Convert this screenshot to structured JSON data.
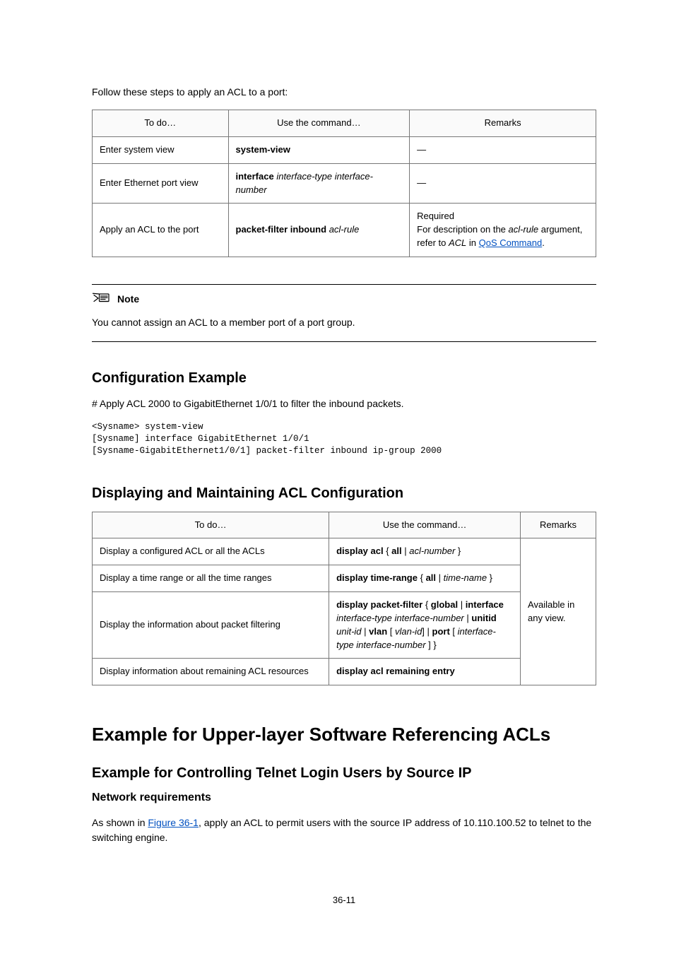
{
  "intro": "Follow these steps to apply an ACL to a port:",
  "steps_table": {
    "headers": [
      "To do…",
      "Use the command…",
      "Remarks"
    ],
    "rows": [
      {
        "todo": "Enter system view",
        "cmd_html": "<span class='b'>system-view</span>",
        "remark_html": "—"
      },
      {
        "todo": "Enter Ethernet port view",
        "cmd_html": "<span class='b'>interface</span> <span class='i'>interface-type interface-number</span>",
        "remark_html": "—"
      },
      {
        "todo": "Apply an ACL to the port",
        "cmd_html": "<span class='b'>packet-filter inbound</span> <span class='i'>acl-rule</span>",
        "remark_html": "Required<br>For description on the <span class='i'>acl-rule</span> argument, refer to <span class='i'>ACL</span> in <a class='link' href='#' data-name='qos-cmd-link' data-interactable='true'>QoS Command</a>."
      }
    ]
  },
  "note": {
    "label": "Note",
    "body": "You cannot assign an ACL to a member port of a port group."
  },
  "example": {
    "heading": "Configuration Example",
    "text": "# Apply ACL 2000 to GigabitEthernet 1/0/1 to filter the inbound packets.",
    "console": "<Sysname> system-view\n[Sysname] interface GigabitEthernet 1/0/1\n[Sysname-GigabitEthernet1/0/1] packet-filter inbound ip-group 2000"
  },
  "display": {
    "heading": "Displaying and Maintaining ACL Configuration",
    "headers": [
      "To do…",
      "Use the command…",
      "Remarks"
    ],
    "remark": "Available in any view.",
    "rows": [
      {
        "todo": "Display a configured ACL or all the ACLs",
        "cmd_html": "<span class='b'>display acl</span> { <span class='b'>all</span> | <span class='i'>acl-number</span> }"
      },
      {
        "todo": "Display a time range or all the time ranges",
        "cmd_html": "<span class='b'>display time-range</span> { <span class='b'>all</span> | <span class='i'>time-name</span> }"
      },
      {
        "todo": "Display the information about packet filtering",
        "cmd_html": "<span class='b'>display packet-filter</span> { <span class='b'>global</span> | <span class='b'>interface</span> <span class='i'>interface-type interface-number</span> | <span class='b'>unitid</span> <span class='i'>unit-id</span> | <span class='b'>vlan</span> [ <span class='i'>vlan-id</span>] | <span class='b'>port</span> [ <span class='i'>interface-type interface-number</span> ] }"
      },
      {
        "todo": "Display information about remaining ACL resources",
        "cmd_html": "<span class='b'>display acl remaining entry</span>"
      }
    ]
  },
  "examples_section": {
    "chapter_heading": "Example for Upper-layer Software Referencing ACLs",
    "sub_heading": "Example for Controlling Telnet Login Users by Source IP",
    "nr_heading": "Network requirements",
    "nr_text_pre": "As shown in ",
    "nr_link": "Figure 36-1",
    "nr_text_post": ", apply an ACL to permit users with the source IP address of 10.110.100.52 to telnet to the switching engine."
  },
  "page_number": "36-11",
  "chart_data": null
}
